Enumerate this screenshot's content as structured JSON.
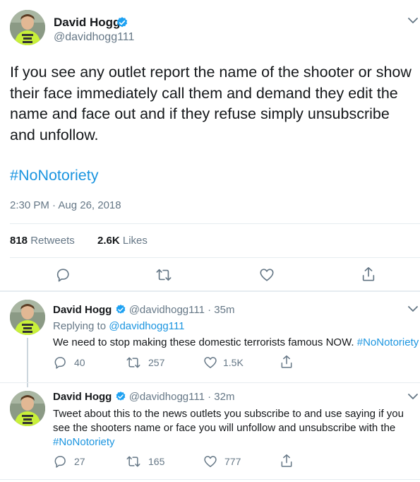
{
  "main_tweet": {
    "author_name": "David Hogg",
    "handle": "@davidhogg111",
    "text": "If you see any outlet report the name of the shooter or show their face immediately call them and demand they edit the name and face out and if they refuse simply unsubscribe and unfollow.",
    "hashtag": "#NoNotoriety",
    "timestamp": "2:30 PM · Aug 26, 2018",
    "retweets_count": "818",
    "retweets_label": "Retweets",
    "likes_count": "2.6K",
    "likes_label": "Likes"
  },
  "replies": [
    {
      "author_name": "David Hogg",
      "handle": "@davidhogg111",
      "age": "· 35m",
      "replying_prefix": "Replying to",
      "replying_handle": "@davidhogg111",
      "text": "We need to stop making these domestic terrorists famous NOW.",
      "hashtag": "#NoNotoriety",
      "reply_count": "40",
      "retweet_count": "257",
      "like_count": "1.5K"
    },
    {
      "author_name": "David Hogg",
      "handle": "@davidhogg111",
      "age": "· 32m",
      "text": "Tweet about this to the news outlets you subscribe to and use saying if you see the shooters name or face you will unfollow and unsubscribe with the",
      "hashtag": "#NoNotoriety",
      "reply_count": "27",
      "retweet_count": "165",
      "like_count": "777"
    }
  ],
  "colors": {
    "link": "#1b95e0",
    "muted": "#657786",
    "verified": "#1da1f2",
    "avatar_shirt": "#c8f03a"
  },
  "icons": [
    "chevron-down-icon",
    "verified-badge-icon",
    "reply-icon",
    "retweet-icon",
    "heart-icon",
    "share-icon"
  ]
}
